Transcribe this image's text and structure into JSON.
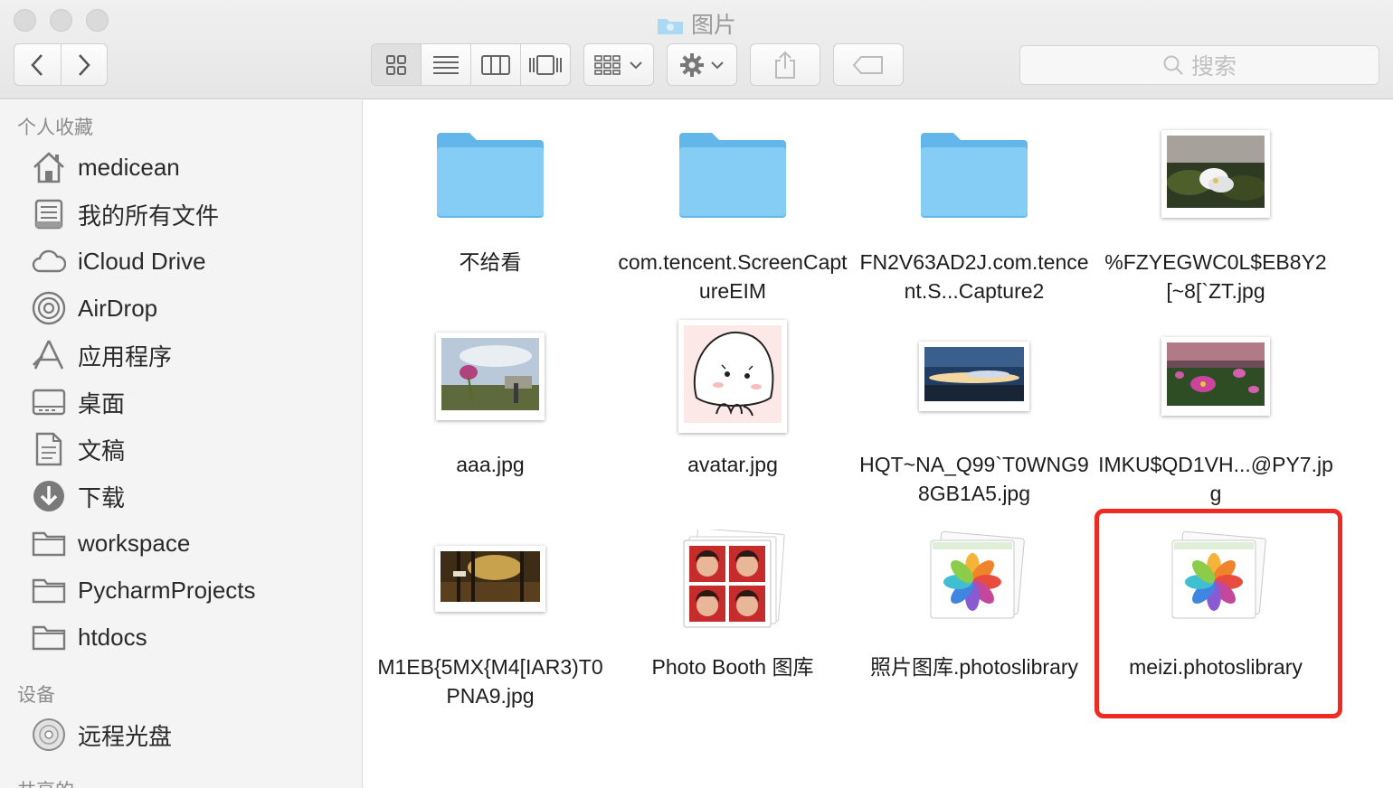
{
  "window": {
    "title": "图片",
    "search_placeholder": "搜索"
  },
  "toolbar": {
    "back": "back",
    "forward": "forward",
    "view_modes": [
      "icon-view",
      "list-view",
      "column-view",
      "coverflow-view"
    ],
    "active_view": "icon-view"
  },
  "sidebar": {
    "favorites_header": "个人收藏",
    "favorites": [
      {
        "label": "medicean",
        "icon": "home-icon"
      },
      {
        "label": "我的所有文件",
        "icon": "all-files-icon"
      },
      {
        "label": "iCloud Drive",
        "icon": "cloud-icon"
      },
      {
        "label": "AirDrop",
        "icon": "airdrop-icon"
      },
      {
        "label": "应用程序",
        "icon": "applications-icon"
      },
      {
        "label": "桌面",
        "icon": "desktop-icon"
      },
      {
        "label": "文稿",
        "icon": "documents-icon"
      },
      {
        "label": "下载",
        "icon": "downloads-icon"
      },
      {
        "label": "workspace",
        "icon": "folder-icon"
      },
      {
        "label": "PycharmProjects",
        "icon": "folder-icon"
      },
      {
        "label": "htdocs",
        "icon": "folder-icon"
      }
    ],
    "devices_header": "设备",
    "devices": [
      {
        "label": "远程光盘",
        "icon": "disc-icon"
      }
    ],
    "shared_header": "共享的"
  },
  "files": [
    {
      "name": "不给看",
      "kind": "folder"
    },
    {
      "name": "com.tencent.ScreenCaptureEIM",
      "kind": "folder"
    },
    {
      "name": "FN2V63AD2J.com.tencent.S...Capture2",
      "kind": "folder"
    },
    {
      "name": "%FZYEGWC0L$EB8Y2[~8[`ZT.jpg",
      "kind": "photo-flower-white"
    },
    {
      "name": "aaa.jpg",
      "kind": "photo-flower-sky"
    },
    {
      "name": "avatar.jpg",
      "kind": "photo-avatar"
    },
    {
      "name": "HQT~NA_Q99`T0WNG98GB1A5.jpg",
      "kind": "photo-sunset"
    },
    {
      "name": "IMKU$QD1VH...@PY7.jpg",
      "kind": "photo-cosmos"
    },
    {
      "name": "M1EB{5MX{M4[IAR3)T0PNA9.jpg",
      "kind": "photo-forest"
    },
    {
      "name": "Photo Booth 图库",
      "kind": "photobooth-library"
    },
    {
      "name": "照片图库.photoslibrary",
      "kind": "photos-library"
    },
    {
      "name": "meizi.photoslibrary",
      "kind": "photos-library",
      "highlighted": true
    }
  ],
  "colors": {
    "folder": "#7cc8f2",
    "highlight": "#ee2a23",
    "sidebar_bg": "#f4f4f4"
  }
}
